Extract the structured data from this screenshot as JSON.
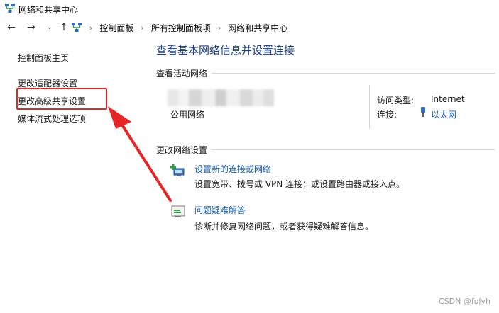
{
  "window": {
    "title": "网络和共享中心"
  },
  "breadcrumb": [
    "控制面板",
    "所有控制面板项",
    "网络和共享中心"
  ],
  "sidebar": {
    "items": [
      {
        "label": "控制面板主页"
      },
      {
        "label": "更改适配器设置"
      },
      {
        "label": "更改高级共享设置"
      },
      {
        "label": "媒体流式处理选项"
      }
    ],
    "highlighted_index": 2
  },
  "main": {
    "title": "查看基本网络信息并设置连接",
    "active_networks": {
      "header": "查看活动网络",
      "network_type": "公用网络",
      "access_type_label": "访问类型:",
      "access_type_value": "Internet",
      "connection_label": "连接:",
      "connection_value": "以太网"
    },
    "change_settings": {
      "header": "更改网络设置",
      "tasks": [
        {
          "title": "设置新的连接或网络",
          "description": "设置宽带、拨号或 VPN 连接；或设置路由器或接入点。",
          "icon": "new-connection-icon"
        },
        {
          "title": "问题疑难解答",
          "description": "诊断并修复网络问题，或者获得疑难解答信息。",
          "icon": "troubleshoot-icon"
        }
      ]
    }
  },
  "annotation": {
    "color": "#e82525"
  },
  "watermark": "CSDN @folyh"
}
